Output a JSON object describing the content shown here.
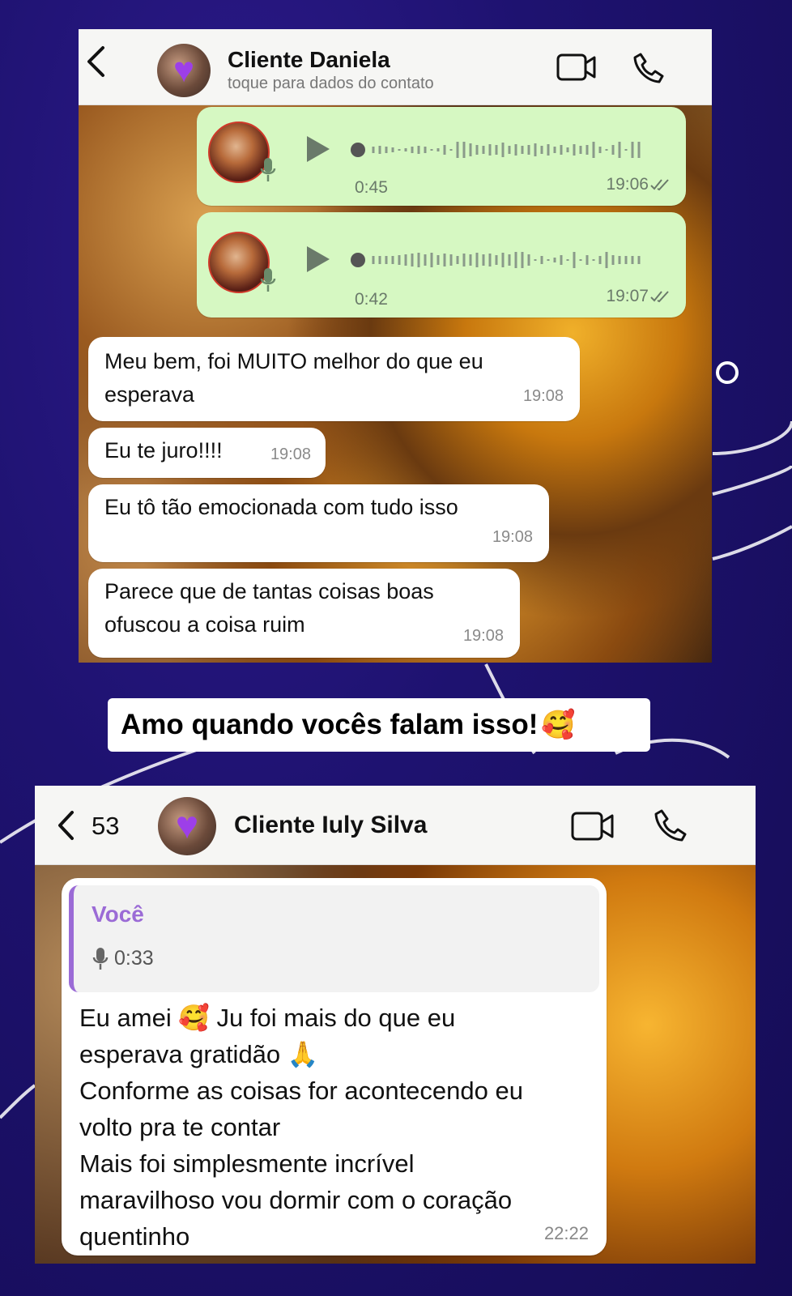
{
  "chat1": {
    "contact_name": "Cliente Daniela",
    "contact_subtitle": "toque para dados do contato",
    "voice_messages": [
      {
        "duration": "0:45",
        "time": "19:06"
      },
      {
        "duration": "0:42",
        "time": "19:07"
      }
    ],
    "messages": [
      {
        "line1": "Meu bem, foi MUITO melhor do que eu",
        "line2": "esperava",
        "time": "19:08"
      },
      {
        "line1": "Eu te juro!!!!",
        "time": "19:08"
      },
      {
        "line1": "Eu tô tão emocionada com tudo isso",
        "time": "19:08"
      },
      {
        "line1": "Parece que de tantas coisas boas",
        "line2": "ofuscou a coisa ruim",
        "time": "19:08"
      }
    ]
  },
  "caption": {
    "text": "Amo quando vocês falam isso!",
    "emoji": "🥰"
  },
  "chat2": {
    "back_count": "53",
    "contact_name": "Cliente Iuly Silva",
    "quote_author": "Você",
    "quote_duration": "0:33",
    "message_lines": [
      "Eu amei 🥰 Ju foi mais do que eu",
      "esperava gratidão 🙏",
      "Conforme as coisas for acontecendo eu",
      "volto pra te contar",
      "Mais foi simplesmente incrível",
      "maravilhoso vou dormir com o coração",
      "quentinho"
    ],
    "time": "22:22"
  },
  "colors": {
    "background": "#1e1270",
    "outgoing_bubble": "#d6f8c2",
    "incoming_bubble": "#ffffff",
    "quote_accent": "#9b6bd6",
    "avatar_heart": "#9d3fe8"
  },
  "icons": [
    "back-chevron-icon",
    "purple-heart-icon",
    "video-camera-icon",
    "phone-icon",
    "play-icon",
    "microphone-icon",
    "double-check-icon"
  ]
}
